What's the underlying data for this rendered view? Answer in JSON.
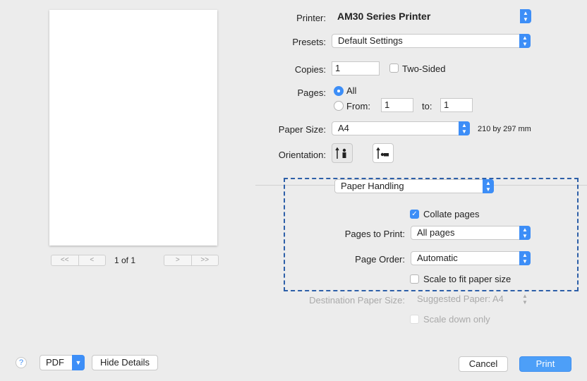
{
  "preview": {
    "page_indicator": "1 of 1",
    "first_btn": "<<",
    "prev_btn": "<",
    "next_btn": ">",
    "last_btn": ">>"
  },
  "printer": {
    "label": "Printer:",
    "value": "AM30 Series Printer"
  },
  "presets": {
    "label": "Presets:",
    "value": "Default Settings"
  },
  "copies": {
    "label": "Copies:",
    "value": "1",
    "two_sided_label": "Two-Sided"
  },
  "pages": {
    "label": "Pages:",
    "all_label": "All",
    "from_label": "From:",
    "from_value": "1",
    "to_label": "to:",
    "to_value": "1"
  },
  "paper_size": {
    "label": "Paper Size:",
    "value": "A4",
    "dimensions": "210 by 297 mm"
  },
  "orientation": {
    "label": "Orientation:"
  },
  "section_popup": {
    "value": "Paper Handling"
  },
  "collate": {
    "label": "Collate pages",
    "checked": true
  },
  "pages_to_print": {
    "label": "Pages to Print:",
    "value": "All pages"
  },
  "page_order": {
    "label": "Page Order:",
    "value": "Automatic"
  },
  "scale_to_fit": {
    "label": "Scale to fit paper size",
    "checked": false
  },
  "destination": {
    "label": "Destination Paper Size:",
    "value": "Suggested Paper: A4"
  },
  "scale_down": {
    "label": "Scale down only"
  },
  "footer": {
    "help": "?",
    "pdf_label": "PDF",
    "hide_details": "Hide Details",
    "cancel": "Cancel",
    "print": "Print"
  },
  "colors": {
    "accent": "#3d8ef7",
    "highlight_border": "#2d5fa8"
  }
}
